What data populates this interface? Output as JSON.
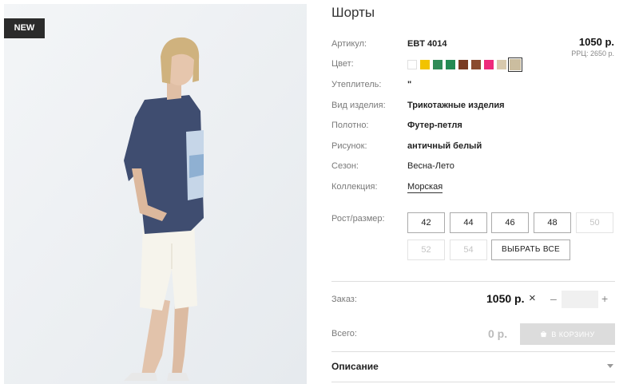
{
  "badge": "NEW",
  "product": {
    "title": "Шорты",
    "price": "1050 р.",
    "rrp": "РРЦ: 2650 р."
  },
  "details": {
    "article_label": "Артикул:",
    "article_value": "EBT 4014",
    "color_label": "Цвет:",
    "insulation_label": "Утеплитель:",
    "insulation_value": "\"",
    "type_label": "Вид изделия:",
    "type_value": "Трикотажные изделия",
    "fabric_label": "Полотно:",
    "fabric_value": "Футер-петля",
    "pattern_label": "Рисунок:",
    "pattern_value": "античный белый",
    "season_label": "Сезон:",
    "season_value": "Весна-Лето",
    "collection_label": "Коллекция:",
    "collection_value": "Морская"
  },
  "colors": [
    "#ffffff",
    "#f2c300",
    "#2e8b57",
    "#238a53",
    "#7a3b22",
    "#8a4a2e",
    "#ee2a7b",
    "#d8c9ad",
    "#cbbd9f"
  ],
  "sizes": {
    "label": "Рост/размер:",
    "items": [
      {
        "label": "42",
        "disabled": false
      },
      {
        "label": "44",
        "disabled": false
      },
      {
        "label": "46",
        "disabled": false
      },
      {
        "label": "48",
        "disabled": false
      },
      {
        "label": "50",
        "disabled": true
      },
      {
        "label": "52",
        "disabled": true
      },
      {
        "label": "54",
        "disabled": true
      }
    ],
    "select_all": "ВЫБРАТЬ ВСЕ"
  },
  "order": {
    "label": "Заказ:",
    "price": "1050 р.",
    "times": "×",
    "minus": "–",
    "plus": "+",
    "quantity": ""
  },
  "total": {
    "label": "Всего:",
    "value": "0 р.",
    "cart_button": "В КОРЗИНУ"
  },
  "description": {
    "title": "Описание"
  }
}
